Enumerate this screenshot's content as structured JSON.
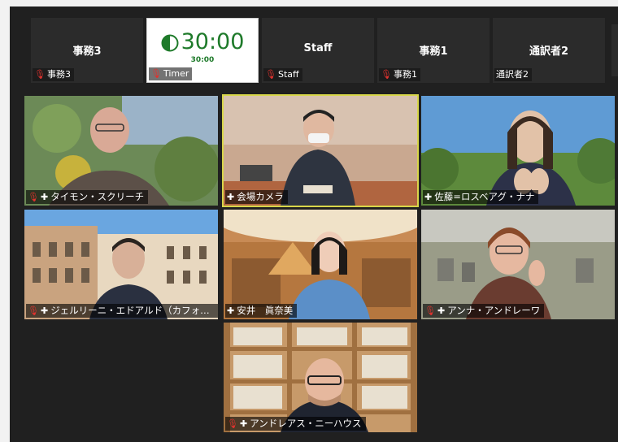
{
  "strip": [
    {
      "title": "事務3",
      "label": "事務3",
      "muted": true
    },
    {
      "title": "",
      "timer": "30:00",
      "timer_small": "30:00",
      "label": "Timer",
      "muted": true
    },
    {
      "title": "Staff",
      "label": "Staff",
      "muted": true
    },
    {
      "title": "事務1",
      "label": "事務1",
      "muted": true
    },
    {
      "title": "通訳者2",
      "label": "通訳者2",
      "muted": false
    }
  ],
  "participants": [
    {
      "name": "タイモン・スクリーチ",
      "muted": true
    },
    {
      "name": "会場カメラ",
      "muted": false,
      "active": true
    },
    {
      "name": "佐藤=ロスベアグ・ナナ",
      "muted": false
    },
    {
      "name": "ジェルリーニ・エドアルド（カフォスカリ…",
      "muted": true
    },
    {
      "name": "安井　眞奈美",
      "muted": false
    },
    {
      "name": "アンナ・アンドレーワ",
      "muted": true
    },
    {
      "name": "アンドレアス・ニーハウス",
      "muted": true
    }
  ],
  "colors": {
    "timer_green": "#1e7a2a",
    "active_border": "#d8d64a",
    "muted_red": "#e0322e"
  }
}
